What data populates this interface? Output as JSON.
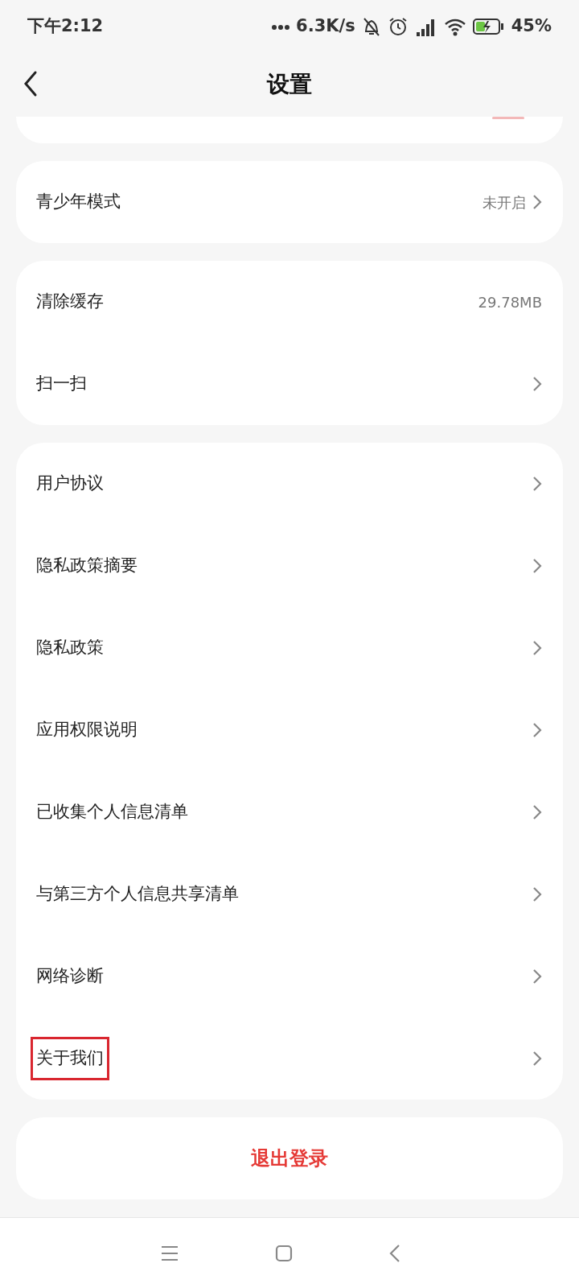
{
  "status_bar": {
    "time": "下午2:12",
    "speed": "6.3K/s",
    "battery": "45%"
  },
  "header": {
    "title": "设置"
  },
  "groups": [
    {
      "items": [
        {
          "label": "青少年模式",
          "value": "未开启",
          "chevron": true,
          "highlighted": false
        }
      ]
    },
    {
      "items": [
        {
          "label": "清除缓存",
          "value": "29.78MB",
          "chevron": false,
          "highlighted": false
        },
        {
          "label": "扫一扫",
          "chevron": true,
          "highlighted": false
        }
      ]
    },
    {
      "items": [
        {
          "label": "用户协议",
          "chevron": true,
          "highlighted": false
        },
        {
          "label": "隐私政策摘要",
          "chevron": true,
          "highlighted": false
        },
        {
          "label": "隐私政策",
          "chevron": true,
          "highlighted": false
        },
        {
          "label": "应用权限说明",
          "chevron": true,
          "highlighted": false
        },
        {
          "label": "已收集个人信息清单",
          "chevron": true,
          "highlighted": false
        },
        {
          "label": "与第三方个人信息共享清单",
          "chevron": true,
          "highlighted": false
        },
        {
          "label": "网络诊断",
          "chevron": true,
          "highlighted": false
        },
        {
          "label": "关于我们",
          "chevron": true,
          "highlighted": true
        }
      ]
    }
  ],
  "logout": {
    "label": "退出登录"
  }
}
